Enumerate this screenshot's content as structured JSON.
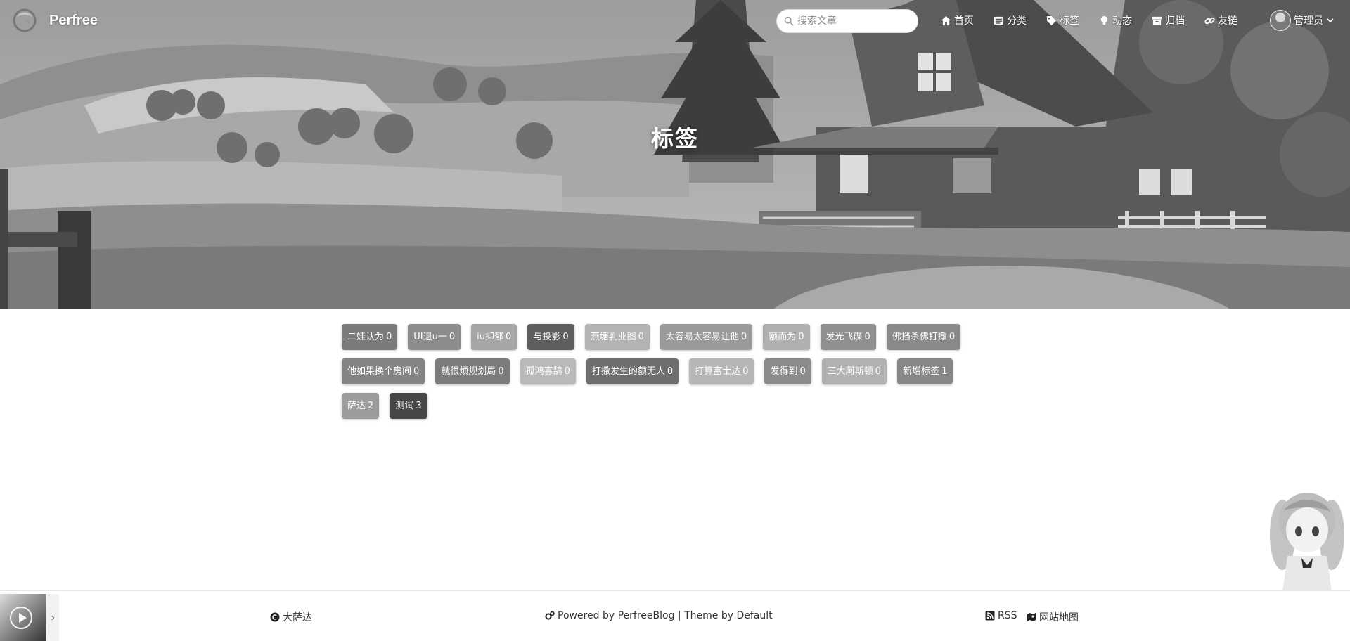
{
  "site": {
    "brand": "Perfree"
  },
  "search": {
    "placeholder": "搜索文章"
  },
  "menu": [
    {
      "label": "首页",
      "icon": "home-icon"
    },
    {
      "label": "分类",
      "icon": "list-icon"
    },
    {
      "label": "标签",
      "icon": "tag-icon"
    },
    {
      "label": "动态",
      "icon": "lightbulb-icon"
    },
    {
      "label": "归档",
      "icon": "archive-icon"
    },
    {
      "label": "友链",
      "icon": "link-icon"
    }
  ],
  "user": {
    "name": "管理员"
  },
  "page": {
    "title": "标签"
  },
  "tags": [
    [
      {
        "name": "二娃认为",
        "count": "0",
        "color": "#7a7a7a"
      },
      {
        "name": "UI退u一",
        "count": "0",
        "color": "#8c8c8c"
      },
      {
        "name": "iu抑郁",
        "count": "0",
        "color": "#a6a6a6"
      },
      {
        "name": "与投影",
        "count": "0",
        "color": "#5e5e5e"
      },
      {
        "name": "燕塘乳业图",
        "count": "0",
        "color": "#b3b3b3"
      },
      {
        "name": "太容易太容易让他",
        "count": "0",
        "color": "#9a9a9a"
      },
      {
        "name": "额而为",
        "count": "0",
        "color": "#b0b0b0"
      },
      {
        "name": "发光飞碟",
        "count": "0",
        "color": "#8f8f8f"
      },
      {
        "name": "佛挡杀佛打撒",
        "count": "0",
        "color": "#8a8a8a"
      }
    ],
    [
      {
        "name": "他如果换个房间",
        "count": "0",
        "color": "#848484"
      },
      {
        "name": "就很烦规划局",
        "count": "0",
        "color": "#7c7c7c"
      },
      {
        "name": "孤鸿寡鹄",
        "count": "0",
        "color": "#b9b9b9"
      },
      {
        "name": "打撒发生的额无人",
        "count": "0",
        "color": "#6e6e6e"
      },
      {
        "name": "打算富士达",
        "count": "0",
        "color": "#b6b6b6"
      },
      {
        "name": "发得到",
        "count": "0",
        "color": "#8b8b8b"
      },
      {
        "name": "三大阿斯顿",
        "count": "0",
        "color": "#b1b1b1"
      },
      {
        "name": "新增标签",
        "count": "1",
        "color": "#878787"
      }
    ],
    [
      {
        "name": "萨达",
        "count": "2",
        "color": "#9c9c9c"
      },
      {
        "name": "测试",
        "count": "3",
        "color": "#474747"
      }
    ]
  ],
  "footer": {
    "copyright": "大萨达",
    "powered_prefix": "Powered by ",
    "powered_blog": "PerfreeBlog",
    "separator": " | ",
    "theme_prefix": "Theme by ",
    "theme_name": "Default",
    "rss": "RSS",
    "sitemap": "网站地图"
  },
  "player": {
    "toggle": "›"
  }
}
